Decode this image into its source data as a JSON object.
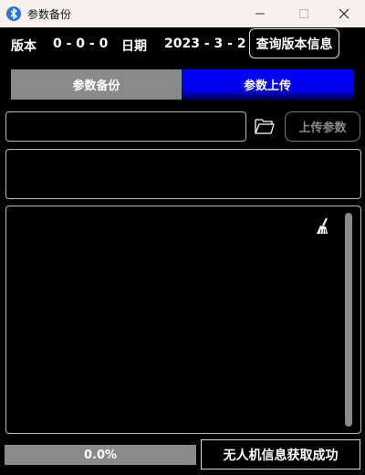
{
  "window": {
    "title": "参数备份",
    "icon": "bluetooth-app-icon"
  },
  "info": {
    "version_label": "版本",
    "version_value": "0 - 0 - 0",
    "date_label": "日期",
    "date_value": "2023 - 3 - 2",
    "query_button": "查询版本信息"
  },
  "tabs": [
    {
      "label": "参数备份",
      "active": false
    },
    {
      "label": "参数上传",
      "active": true
    }
  ],
  "upload": {
    "path_value": "",
    "folder_icon": "folder-open-icon",
    "upload_button": "上传参数"
  },
  "progress": {
    "value": 0.0,
    "text": "0.0%"
  },
  "status": {
    "text": "无人机信息获取成功"
  },
  "colors": {
    "active_tab": "#0000ff",
    "inactive_tab": "#8a8a8a",
    "background": "#000000",
    "titlebar": "#f6f1ef"
  }
}
